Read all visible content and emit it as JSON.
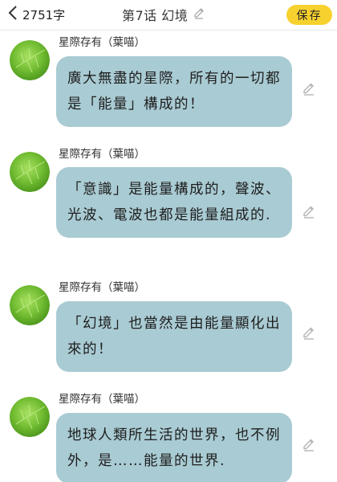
{
  "header": {
    "word_count": "2751字",
    "title": "第7话 幻境",
    "save_label": "保存"
  },
  "messages": [
    {
      "author": "星際存有（葉喵）",
      "text": "廣大無盡的星際，所有的一切都是「能量」構成的！"
    },
    {
      "author": "星際存有（葉喵）",
      "text": "「意識」是能量構成的，聲波、光波、電波也都是能量組成的."
    },
    {
      "author": "星際存有（葉喵）",
      "text": "「幻境」也當然是由能量顯化出來的！"
    },
    {
      "author": "星際存有（葉喵）",
      "text": "地球人類所生活的世界，也不例外，是……能量的世界."
    }
  ],
  "colors": {
    "save_button": "#f7d12e",
    "bubble": "#a9cbd3",
    "avatar": "#7cc43a"
  },
  "icons": {
    "back": "chevron-left-icon",
    "title_edit": "pencil-icon",
    "message_edit": "pencil-icon"
  }
}
